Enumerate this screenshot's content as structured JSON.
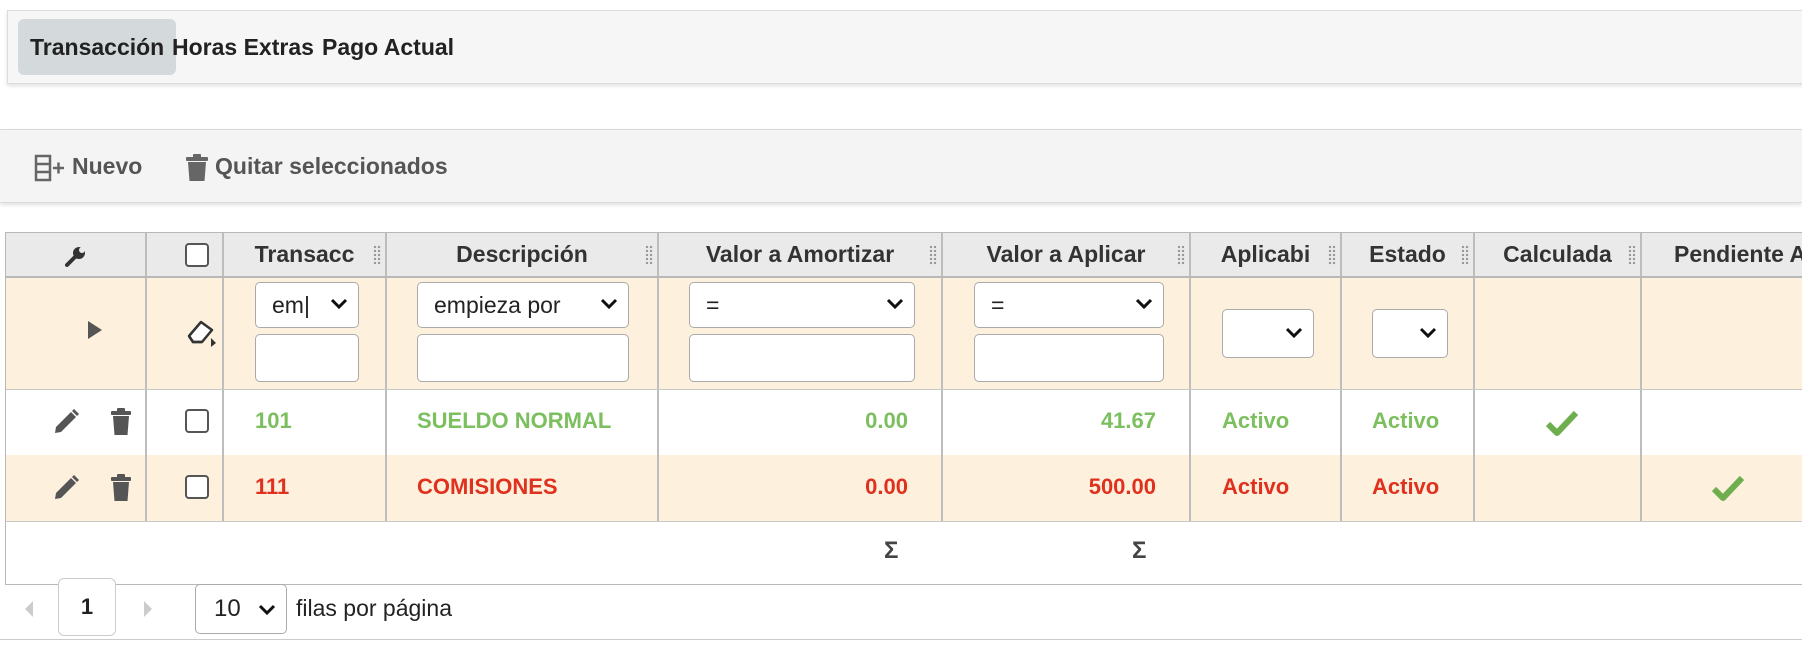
{
  "tabs": [
    {
      "label": "Transacción",
      "active": true
    },
    {
      "label": "Horas Extras",
      "active": false
    },
    {
      "label": "Pago Actual",
      "active": false
    }
  ],
  "toolbar": {
    "new_label": "Nuevo",
    "remove_label": "Quitar seleccionados"
  },
  "grid": {
    "columns": [
      "Transacc",
      "Descripción",
      "Valor a Amortizar",
      "Valor a Aplicar",
      "Aplicabi",
      "Estado",
      "Calculada",
      "Pendiente A"
    ],
    "filters": {
      "transaccion_op": "em|",
      "descripcion_op": "empieza por",
      "amortizar_op": "=",
      "aplicar_op": "="
    },
    "rows": [
      {
        "transaccion": "101",
        "descripcion": "SUELDO NORMAL",
        "valor_amortizar": "0.00",
        "valor_aplicar": "41.67",
        "aplicabilidad": "Activo",
        "estado": "Activo",
        "calculada": true,
        "pendiente": false,
        "color": "#7cbf5e"
      },
      {
        "transaccion": "111",
        "descripcion": "COMISIONES",
        "valor_amortizar": "0.00",
        "valor_aplicar": "500.00",
        "aplicabilidad": "Activo",
        "estado": "Activo",
        "calculada": false,
        "pendiente": true,
        "color": "#e0301e"
      }
    ],
    "sum_symbol": "Σ"
  },
  "pager": {
    "page": "1",
    "page_size": "10",
    "rows_per_page_label": "filas por página"
  }
}
